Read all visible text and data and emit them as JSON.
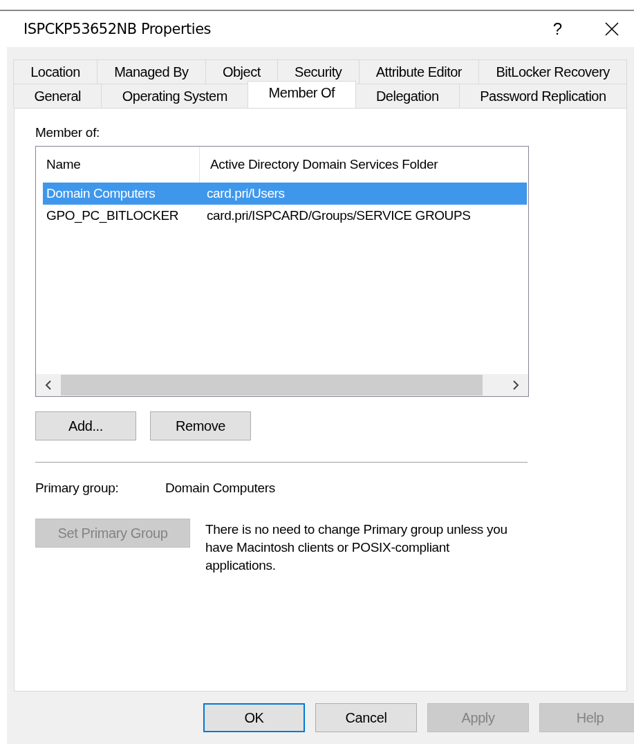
{
  "window": {
    "title": "ISPCKP53652NB Properties",
    "help": "?"
  },
  "tabs": [
    [
      {
        "label": "Location",
        "selected": false
      },
      {
        "label": "Managed By",
        "selected": false
      },
      {
        "label": "Object",
        "selected": false
      },
      {
        "label": "Security",
        "selected": false
      },
      {
        "label": "Attribute Editor",
        "selected": false
      },
      {
        "label": "BitLocker Recovery",
        "selected": false
      }
    ],
    [
      {
        "label": "General",
        "selected": false
      },
      {
        "label": "Operating System",
        "selected": false
      },
      {
        "label": "Member Of",
        "selected": true
      },
      {
        "label": "Delegation",
        "selected": false
      },
      {
        "label": "Password Replication",
        "selected": false
      }
    ]
  ],
  "member_of": {
    "label": "Member of:",
    "columns": [
      "Name",
      "Active Directory Domain Services Folder"
    ],
    "rows": [
      {
        "name": "Domain Computers",
        "folder": "card.pri/Users",
        "selected": true
      },
      {
        "name": "GPO_PC_BITLOCKER",
        "folder": "card.pri/ISPCARD/Groups/SERVICE GROUPS",
        "selected": false
      }
    ]
  },
  "list_buttons": [
    {
      "label": "Add...",
      "disabled": false
    },
    {
      "label": "Remove",
      "disabled": false
    }
  ],
  "primary_group": {
    "label": "Primary group:",
    "value": "Domain Computers"
  },
  "set_primary_button": {
    "label": "Set Primary Group",
    "disabled": true
  },
  "note": "There is no need to change Primary group unless you have Macintosh clients or POSIX-compliant applications.",
  "footer_buttons": [
    {
      "label": "OK",
      "default": true,
      "disabled": false
    },
    {
      "label": "Cancel",
      "default": false,
      "disabled": false
    },
    {
      "label": "Apply",
      "default": false,
      "disabled": true
    },
    {
      "label": "Help",
      "default": false,
      "disabled": true
    }
  ]
}
